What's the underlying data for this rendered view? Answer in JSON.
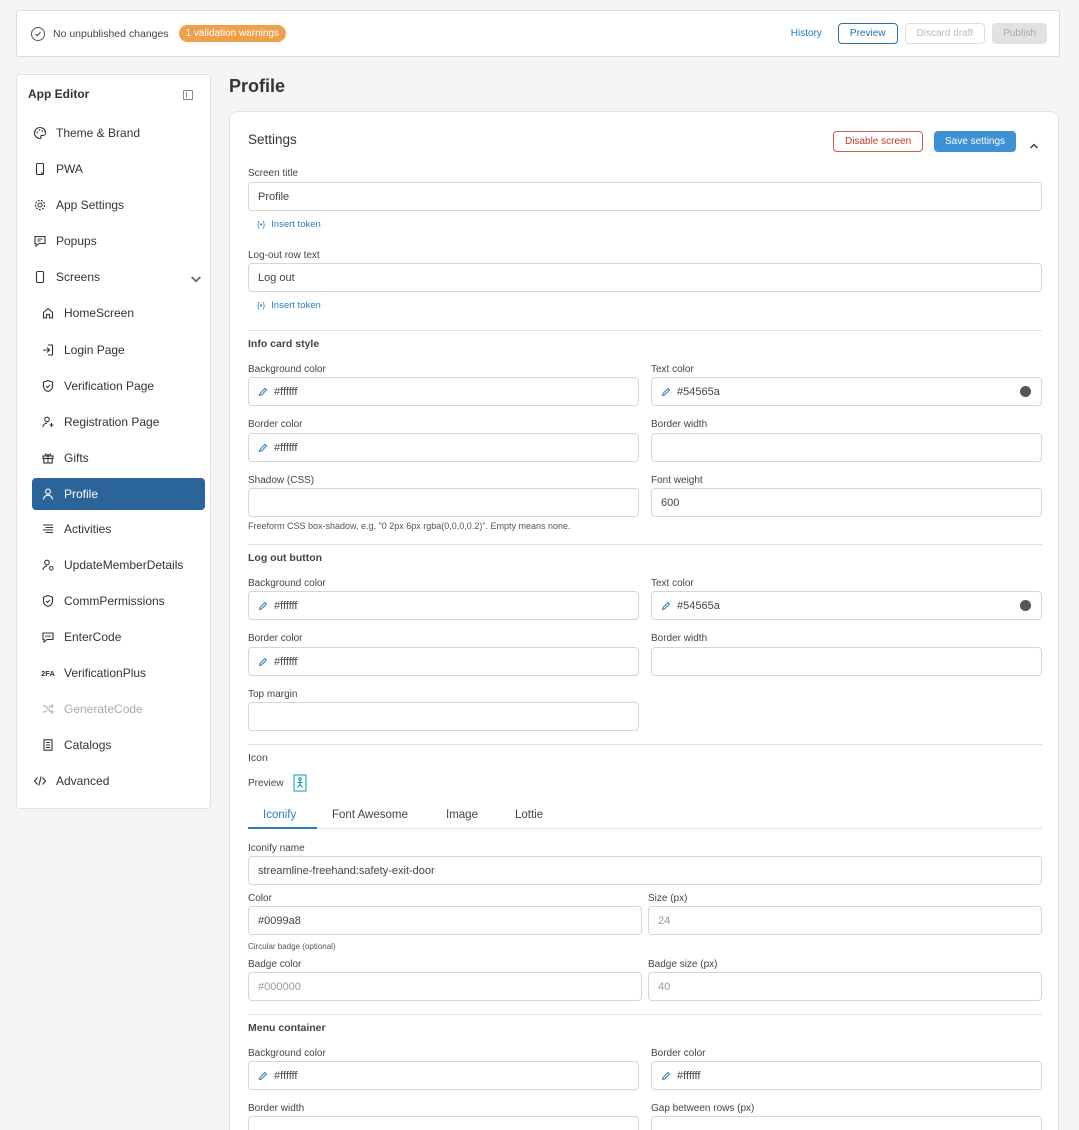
{
  "topbar": {
    "status": "No unpublished changes",
    "warnings": "1 validation warnings",
    "history": "History",
    "preview": "Preview",
    "discard": "Discard draft",
    "publish": "Publish"
  },
  "sidebar": {
    "title": "App Editor",
    "top_items": [
      {
        "label": "Theme & Brand",
        "icon": "palette-icon"
      },
      {
        "label": "PWA",
        "icon": "phone-icon"
      },
      {
        "label": "App Settings",
        "icon": "gear-icon"
      },
      {
        "label": "Popups",
        "icon": "message-icon"
      },
      {
        "label": "Screens",
        "icon": "phone-icon"
      }
    ],
    "screens": [
      {
        "label": "HomeScreen",
        "icon": "home-icon"
      },
      {
        "label": "Login Page",
        "icon": "login-icon"
      },
      {
        "label": "Verification Page",
        "icon": "shield-icon"
      },
      {
        "label": "Registration Page",
        "icon": "user-plus-icon"
      },
      {
        "label": "Gifts",
        "icon": "gift-icon"
      },
      {
        "label": "Profile",
        "icon": "user-icon"
      },
      {
        "label": "Activities",
        "icon": "list-icon"
      },
      {
        "label": "UpdateMemberDetails",
        "icon": "user-edit-icon"
      },
      {
        "label": "CommPermissions",
        "icon": "shield-icon"
      },
      {
        "label": "EnterCode",
        "icon": "code-icon"
      },
      {
        "label": "VerificationPlus",
        "icon": "2fa-icon"
      },
      {
        "label": "GenerateCode",
        "icon": "shuffle-icon"
      },
      {
        "label": "Catalogs",
        "icon": "book-icon"
      }
    ],
    "advanced": "Advanced",
    "twofa": "2FA"
  },
  "main": {
    "page_title": "Profile",
    "settings_title": "Settings",
    "disable": "Disable screen",
    "save": "Save settings",
    "screen_title_label": "Screen title",
    "screen_title_value": "Profile",
    "insert_token": "Insert token",
    "token_glyph": "{•}",
    "logout_label": "Log-out row text",
    "logout_value": "Log out",
    "info_card": {
      "title": "Info card style",
      "bg_label": "Background color",
      "bg": "#ffffff",
      "text_label": "Text color",
      "text": "#54565a",
      "border_label": "Border color",
      "border": "#ffffff",
      "border_width_label": "Border width",
      "shadow_label": "Shadow (CSS)",
      "font_weight_label": "Font weight",
      "font_weight": "600",
      "help": "Freeform CSS box-shadow, e.g. \"0 2px 6px rgba(0,0,0,0.2)\". Empty means none."
    },
    "logout_button": {
      "title": "Log out button",
      "bg_label": "Background color",
      "bg": "#ffffff",
      "text_label": "Text color",
      "text": "#54565a",
      "border_label": "Border color",
      "border": "#ffffff",
      "border_width_label": "Border width",
      "top_margin_label": "Top margin"
    },
    "icon": {
      "title": "Icon",
      "preview": "Preview",
      "tabs": [
        "Iconify",
        "Font Awesome",
        "Image",
        "Lottie"
      ],
      "name_label": "Iconify name",
      "name": "streamline-freehand:safety-exit-door",
      "color_label": "Color",
      "color": "#0099a8",
      "size_label": "Size (px)",
      "size_ph": "24",
      "badge_hint": "Circular badge (optional)",
      "badge_color_label": "Badge color",
      "badge_color_ph": "#000000",
      "badge_size_label": "Badge size (px)",
      "badge_size_ph": "40"
    },
    "menu": {
      "title": "Menu container",
      "bg_label": "Background color",
      "bg": "#ffffff",
      "border_label": "Border color",
      "border": "#ffffff",
      "border_width_label": "Border width",
      "gap_label": "Gap between rows (px)"
    }
  },
  "colors": {
    "accent": "#2b6499",
    "primary": "#3d8fd6",
    "warning": "#f0a04b",
    "danger": "#c0392b",
    "swatch": "#54565a"
  }
}
